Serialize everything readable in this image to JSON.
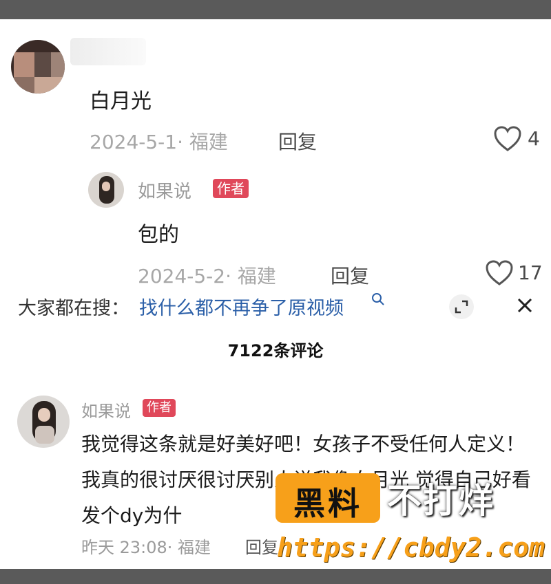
{
  "comment1": {
    "text": "白月光",
    "date_location": "2024-5-1· 福建",
    "reply_label": "回复",
    "likes": "4"
  },
  "reply1": {
    "author": "如果说",
    "author_tag": "作者",
    "text": "包的",
    "date_location": "2024-5-2· 福建",
    "reply_label": "回复",
    "likes": "17"
  },
  "search": {
    "label": "大家都在搜：",
    "query": "找什么都不再争了原视频"
  },
  "comments_header": "7122条评论",
  "comment2": {
    "author": "如果说",
    "author_tag": "作者",
    "text": "我觉得这条就是好美好吧！女孩子不受任何人定义！我真的很讨厌很讨厌别人说我像白月光 觉得自己好看发个dy为什",
    "date_location": "昨天 23:08· 福建",
    "reply_label": "回复"
  },
  "watermark": {
    "badge": "黑料",
    "title": "不打烊",
    "url": "https://cbdy2.com"
  },
  "colors": {
    "author_tag_bg": "#e0485a",
    "search_query": "#2b5fa8",
    "watermark_orange": "#f7a01a"
  }
}
